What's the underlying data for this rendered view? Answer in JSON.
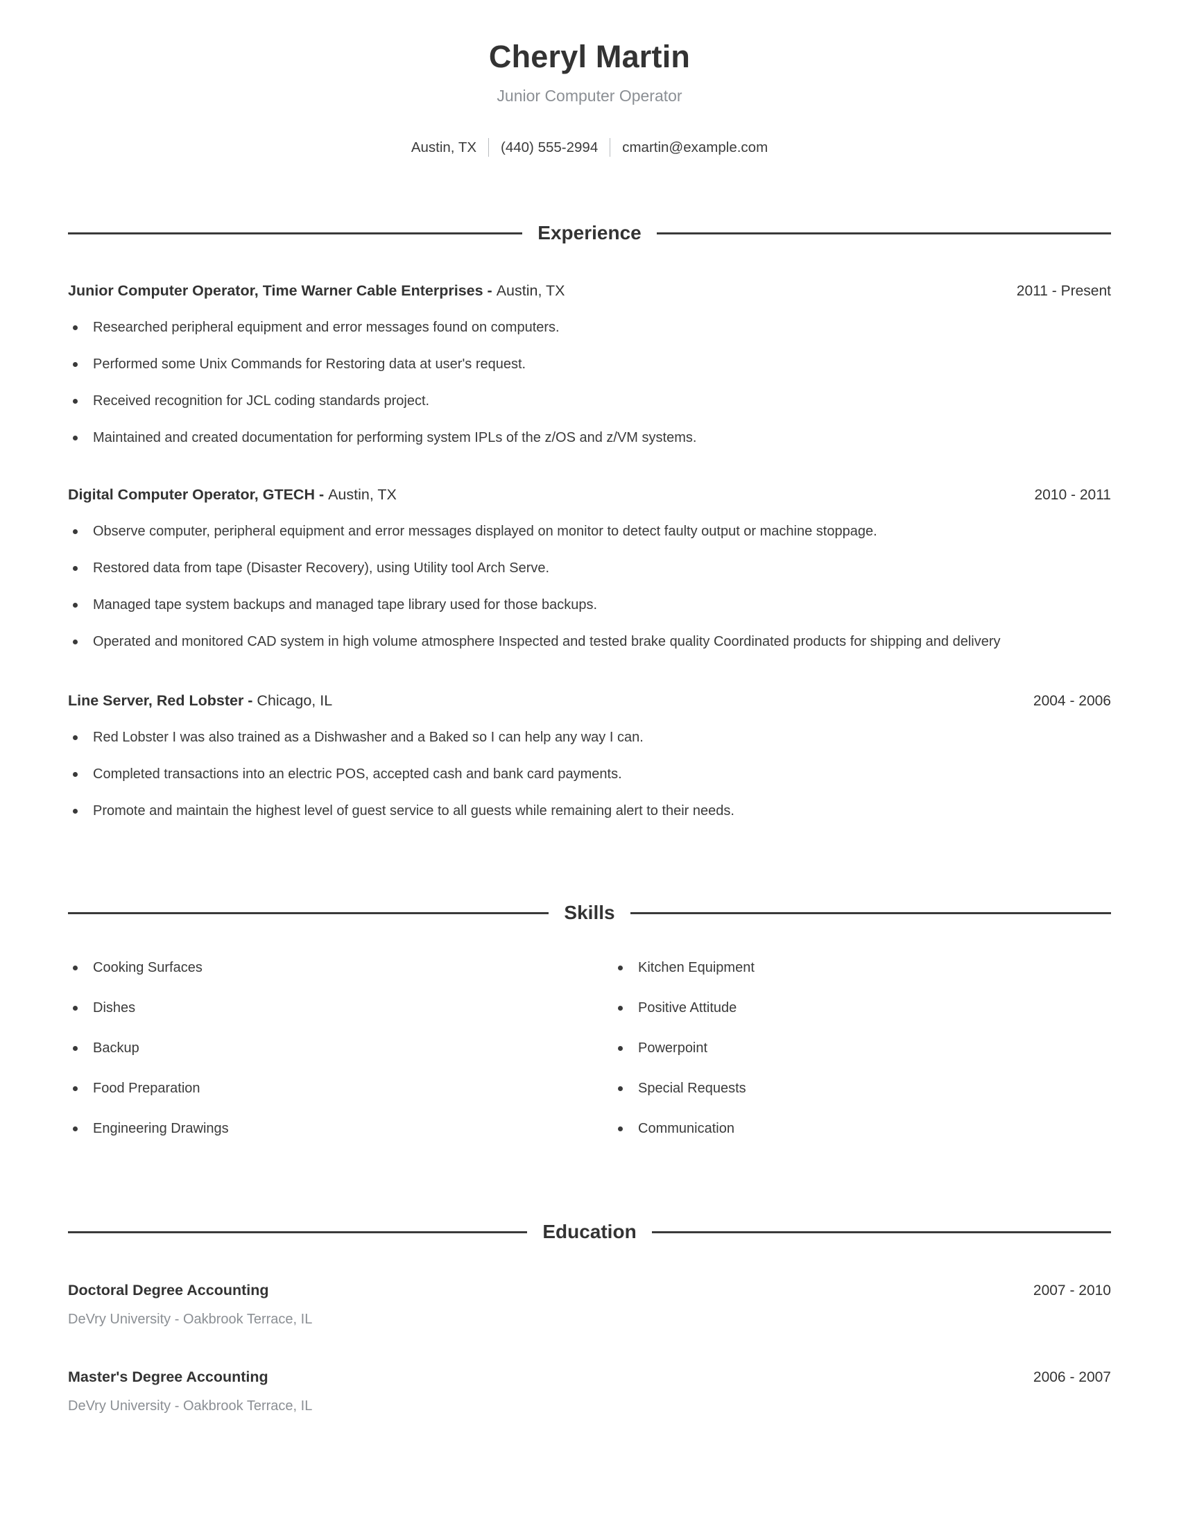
{
  "header": {
    "full_name": "Cheryl Martin",
    "job_title": "Junior Computer Operator",
    "contact": {
      "location": "Austin, TX",
      "phone": "(440) 555-2994",
      "email": "cmartin@example.com"
    }
  },
  "sections": {
    "experience_title": "Experience",
    "skills_title": "Skills",
    "education_title": "Education"
  },
  "experience": [
    {
      "title_bold": "Junior Computer Operator, Time Warner Cable Enterprises - ",
      "title_light": "Austin, TX",
      "date": "2011 - Present",
      "bullets": [
        "Researched peripheral equipment and error messages found on computers.",
        "Performed some Unix Commands for Restoring data at user's request.",
        "Received recognition for JCL coding standards project.",
        "Maintained and created documentation for performing system IPLs of the z/OS and z/VM systems."
      ]
    },
    {
      "title_bold": "Digital Computer Operator, GTECH - ",
      "title_light": "Austin, TX",
      "date": "2010 - 2011",
      "bullets": [
        "Observe computer, peripheral equipment and error messages displayed on monitor to detect faulty output or machine stoppage.",
        "Restored data from tape (Disaster Recovery), using Utility tool Arch Serve.",
        "Managed tape system backups and managed tape library used for those backups.",
        "Operated and monitored CAD system in high volume atmosphere Inspected and tested brake quality Coordinated products for shipping and delivery"
      ]
    },
    {
      "title_bold": "Line Server, Red Lobster - ",
      "title_light": "Chicago, IL",
      "date": "2004 - 2006",
      "bullets": [
        "Red Lobster I was also trained as a Dishwasher and a Baked so I can help any way I can.",
        "Completed transactions into an electric POS, accepted cash and bank card payments.",
        "Promote and maintain the highest level of guest service to all guests while remaining alert to their needs."
      ]
    }
  ],
  "skills": {
    "column_left": [
      "Cooking Surfaces",
      "Dishes",
      "Backup",
      "Food Preparation",
      "Engineering Drawings"
    ],
    "column_right": [
      "Kitchen Equipment",
      "Positive Attitude",
      "Powerpoint",
      "Special Requests",
      "Communication"
    ]
  },
  "education": [
    {
      "degree": "Doctoral Degree Accounting",
      "date": "2007 - 2010",
      "school": "DeVry University - Oakbrook Terrace, IL"
    },
    {
      "degree": "Master's Degree Accounting",
      "date": "2006 - 2007",
      "school": "DeVry University - Oakbrook Terrace, IL"
    }
  ],
  "colors": {
    "text": "#333333",
    "muted": "#8b8f94",
    "rule": "#3a3a3a"
  }
}
